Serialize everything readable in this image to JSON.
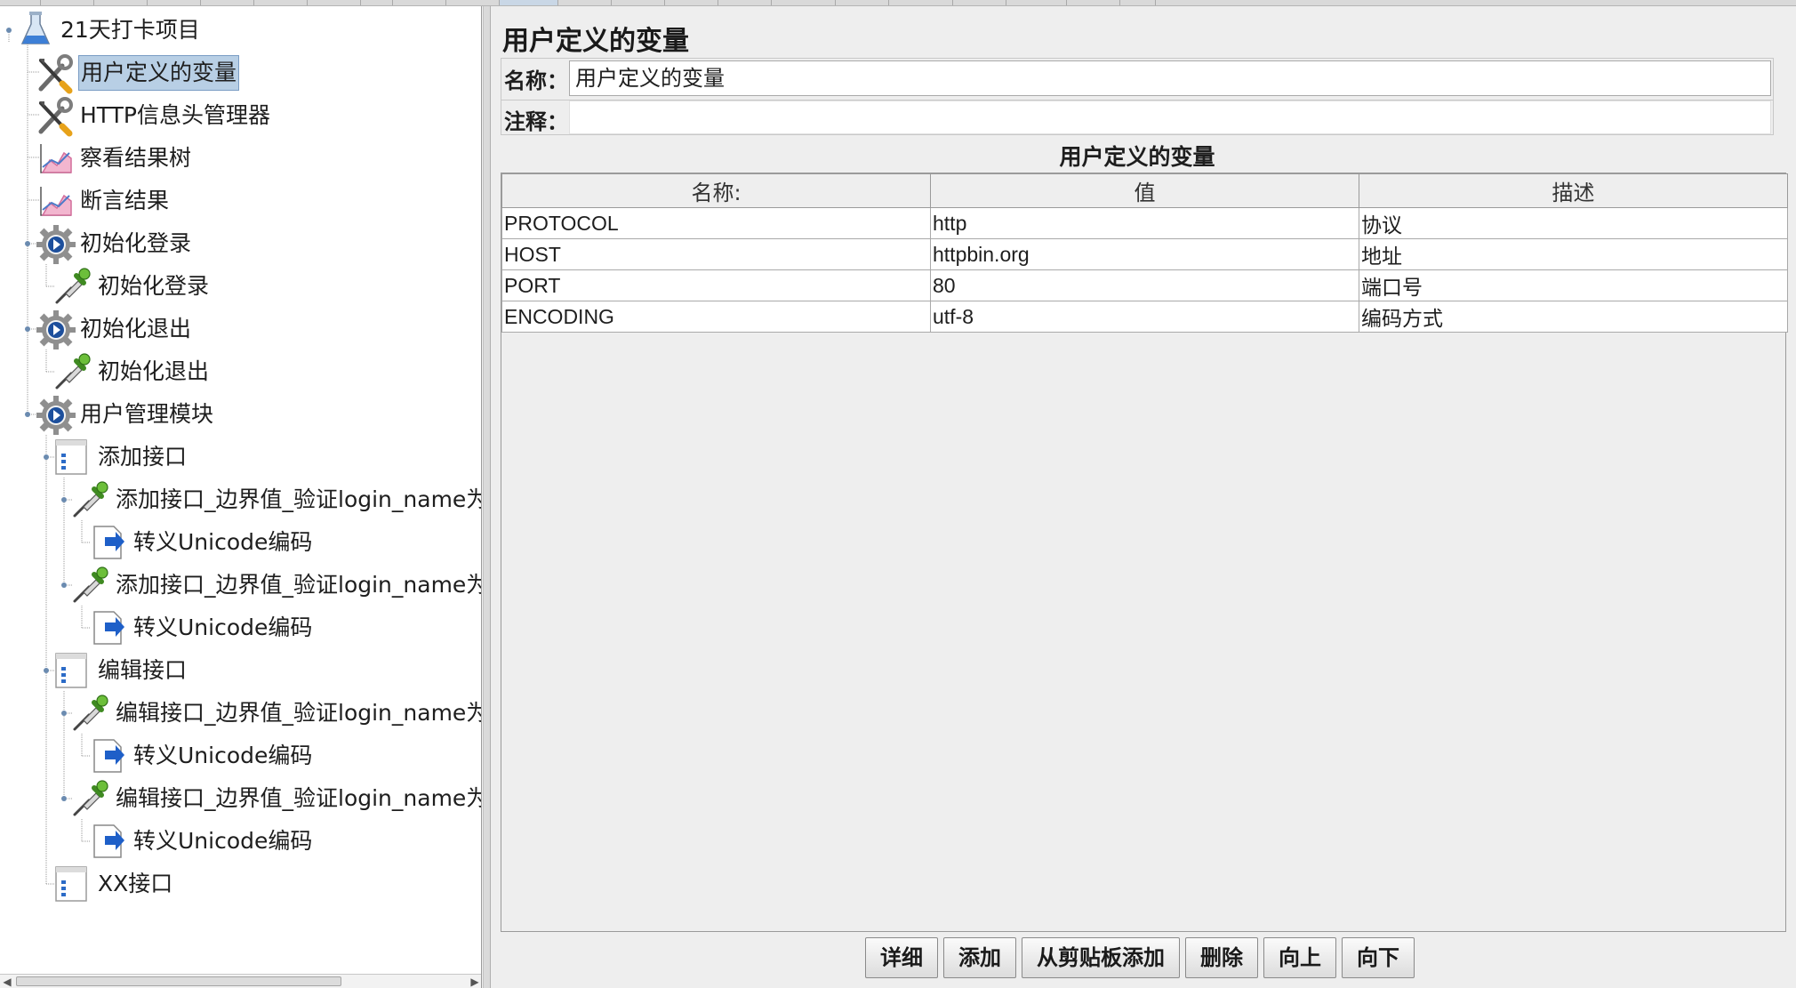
{
  "tree": {
    "nodes": [
      {
        "label": "21天打卡项目",
        "icon": "test-plan-flask-icon"
      },
      {
        "label": "用户定义的变量",
        "icon": "config-wrench-icon",
        "selected": true
      },
      {
        "label": "HTTP信息头管理器",
        "icon": "config-wrench-icon"
      },
      {
        "label": "察看结果树",
        "icon": "listener-graph-icon"
      },
      {
        "label": "断言结果",
        "icon": "listener-graph-icon"
      },
      {
        "label": "初始化登录",
        "icon": "thread-group-gear-icon"
      },
      {
        "label": "初始化登录",
        "icon": "sampler-pipette-icon"
      },
      {
        "label": "初始化退出",
        "icon": "thread-group-gear-icon"
      },
      {
        "label": "初始化退出",
        "icon": "sampler-pipette-icon"
      },
      {
        "label": "用户管理模块",
        "icon": "thread-group-gear-icon"
      },
      {
        "label": "添加接口",
        "icon": "controller-window-icon"
      },
      {
        "label": "添加接口_边界值_验证login_name为一",
        "icon": "sampler-pipette-icon"
      },
      {
        "label": "转义Unicode编码",
        "icon": "postprocessor-arrow-icon"
      },
      {
        "label": "添加接口_边界值_验证login_name为十",
        "icon": "sampler-pipette-icon"
      },
      {
        "label": "转义Unicode编码",
        "icon": "postprocessor-arrow-icon"
      },
      {
        "label": "编辑接口",
        "icon": "controller-window-icon"
      },
      {
        "label": "编辑接口_边界值_验证login_name为一",
        "icon": "sampler-pipette-icon"
      },
      {
        "label": "转义Unicode编码",
        "icon": "postprocessor-arrow-icon"
      },
      {
        "label": "编辑接口_边界值_验证login_name为十",
        "icon": "sampler-pipette-icon"
      },
      {
        "label": "转义Unicode编码",
        "icon": "postprocessor-arrow-icon"
      },
      {
        "label": "XX接口",
        "icon": "controller-window-icon"
      }
    ]
  },
  "panel": {
    "title": "用户定义的变量",
    "name_label": "名称：",
    "name_value": "用户定义的变量",
    "comment_label": "注释：",
    "comment_value": ""
  },
  "table": {
    "title": "用户定义的变量",
    "headers": [
      "名称:",
      "值",
      "描述"
    ],
    "rows": [
      [
        "PROTOCOL",
        "http",
        "协议"
      ],
      [
        "HOST",
        "httpbin.org",
        "地址"
      ],
      [
        "PORT",
        "80",
        "端口号"
      ],
      [
        "ENCODING",
        "utf-8",
        "编码方式"
      ]
    ]
  },
  "buttons": [
    "详细",
    "添加",
    "从剪贴板添加",
    "删除",
    "向上",
    "向下"
  ],
  "colors": {
    "selection": "#b8cfe5",
    "sampler_green": "#4a9a2a",
    "arrow_blue": "#1e5fc8",
    "gear_blue": "#1d4f9c"
  }
}
